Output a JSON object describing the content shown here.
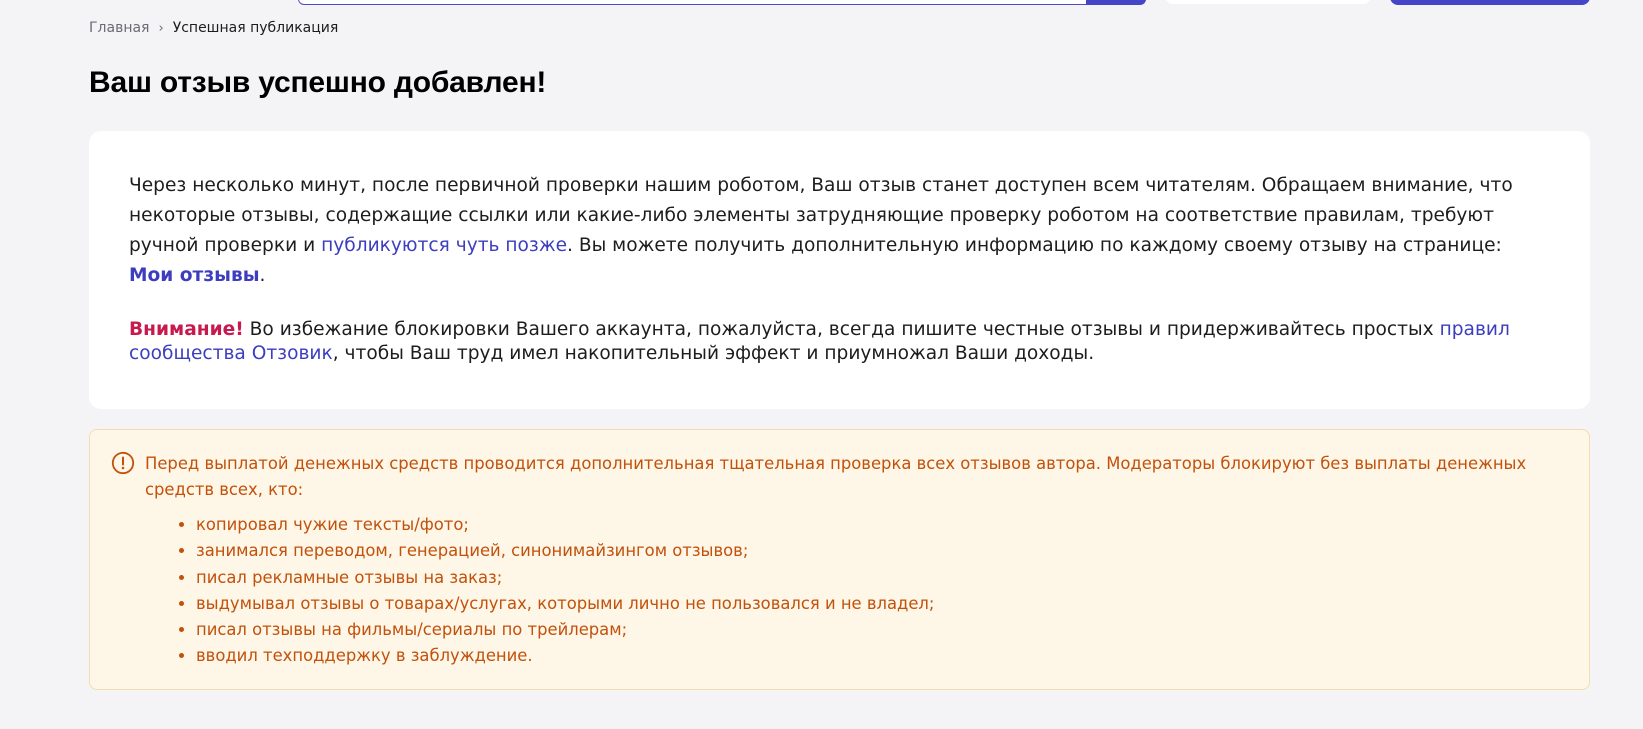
{
  "breadcrumb": {
    "home": "Главная",
    "separator": "›",
    "current": "Успешная публикация"
  },
  "page_title": "Ваш отзыв успешно добавлен!",
  "card": {
    "p1_text1": "Через несколько минут, после первичной проверки нашим роботом, Ваш отзыв станет доступен всем читателям. Обращаем внимание, что некоторые отзывы, содержащие ссылки или какие-либо элементы затрудняющие проверку роботом на соответствие правилам, требуют ручной проверки и ",
    "p1_link": "публикуются чуть позже",
    "p1_text2": ". Вы можете получить дополнительную информацию по каждому своему отзыву на странице: ",
    "p1_link_bold": "Мои отзывы",
    "p1_end": ".",
    "p2_warning": "Внимание!",
    "p2_text1": " Во избежание блокировки Вашего аккаунта, пожалуйста, всегда пишите честные отзывы и придерживайтесь простых ",
    "p2_link": "правил сообщества Отзовик",
    "p2_text2": ", чтобы Ваш труд имел накопительный эффект и приумножал Ваши доходы."
  },
  "notice": {
    "icon": "exclamation-circle-icon",
    "text": "Перед выплатой денежных средств проводится дополнительная тщательная проверка всех отзывов автора. Модераторы блокируют без выплаты денежных средств всех, кто:",
    "items": [
      "копировал чужие тексты/фото;",
      "занимался переводом, генерацией, синонимайзингом отзывов;",
      "писал рекламные отзывы на заказ;",
      "выдумывал отзывы о товарах/услугах, которыми лично не пользовался и не владел;",
      "писал отзывы на фильмы/сериалы по трейлерам;",
      "вводил техподдержку в заблуждение."
    ]
  },
  "colors": {
    "accent": "#4545c9",
    "warning_red": "#c8194f",
    "notice_text": "#c2510c",
    "notice_bg": "#fef6e6"
  }
}
